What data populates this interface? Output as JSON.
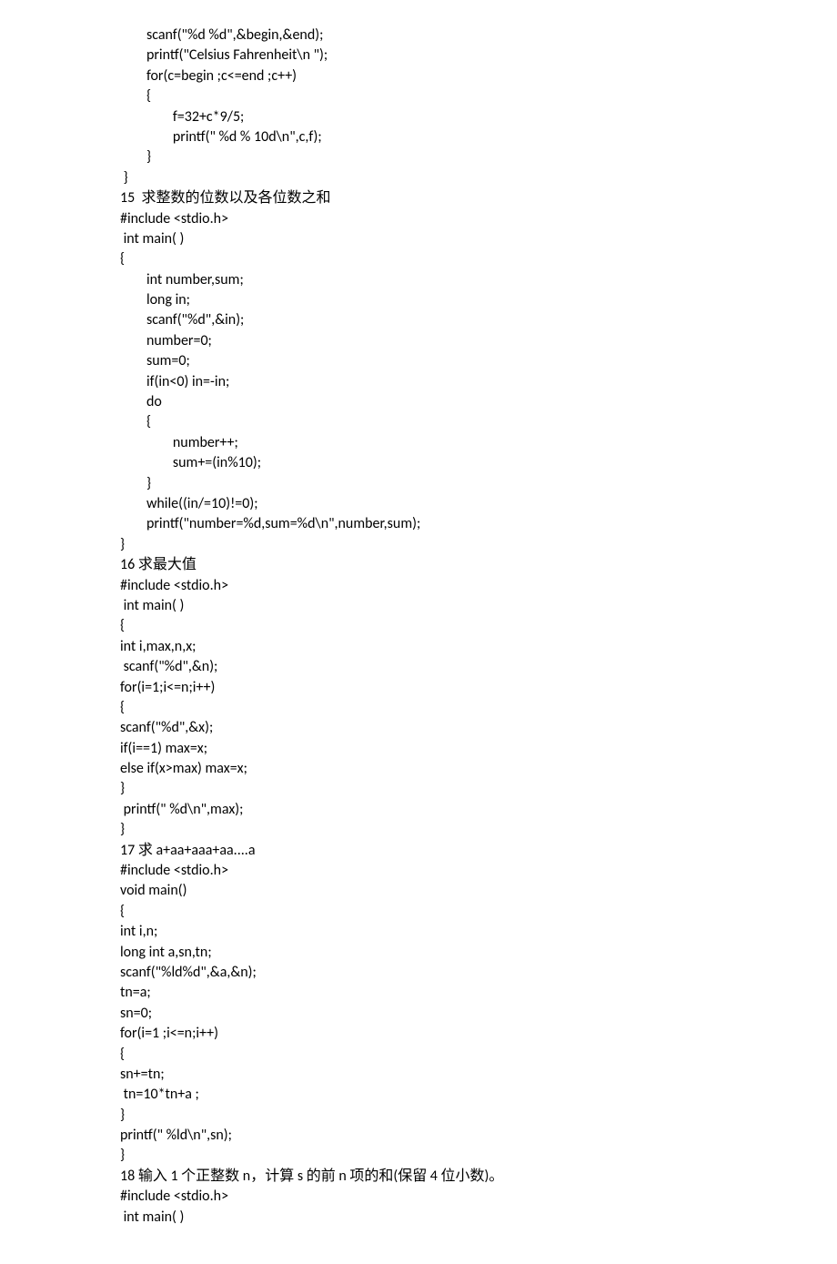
{
  "lines": [
    "        scanf(\"%d %d\",&begin,&end);",
    "        printf(\"Celsius Fahrenheit\\n \");",
    "        for(c=begin ;c<=end ;c++)",
    "        {",
    "                f=32+c*9/5;",
    "                printf(\" %d % 10d\\n\",c,f);",
    "        }",
    " }",
    "15  求整数的位数以及各位数之和",
    "#include <stdio.h>",
    " int main( )",
    "{",
    "        int number,sum;",
    "        long in;",
    "        scanf(\"%d\",&in);",
    "        number=0;",
    "        sum=0;",
    "        if(in<0) in=-in;",
    "        do",
    "        {",
    "                number++;",
    "                sum+=(in%10);",
    "        }",
    "        while((in/=10)!=0);",
    "        printf(\"number=%d,sum=%d\\n\",number,sum);",
    "}",
    "16 求最大值",
    "#include <stdio.h>",
    " int main( )",
    "{",
    "int i,max,n,x;",
    " scanf(\"%d\",&n);",
    "for(i=1;i<=n;i++)",
    "{",
    "scanf(\"%d\",&x);",
    "if(i==1) max=x;",
    "else if(x>max) max=x;",
    "}",
    " printf(\" %d\\n\",max);",
    "}",
    "17 求 a+aa+aaa+aa....a",
    "#include <stdio.h>",
    "void main()",
    "{",
    "int i,n;",
    "long int a,sn,tn;",
    "scanf(\"%ld%d\",&a,&n);",
    "tn=a;",
    "sn=0;",
    "for(i=1 ;i<=n;i++)",
    "{",
    "sn+=tn;",
    " tn=10*tn+a ;",
    "}",
    "printf(\" %ld\\n\",sn);",
    "}",
    "18 输入 1 个正整数 n，计算 s 的前 n 项的和(保留 4 位小数)。",
    "#include <stdio.h>",
    " int main( )"
  ]
}
